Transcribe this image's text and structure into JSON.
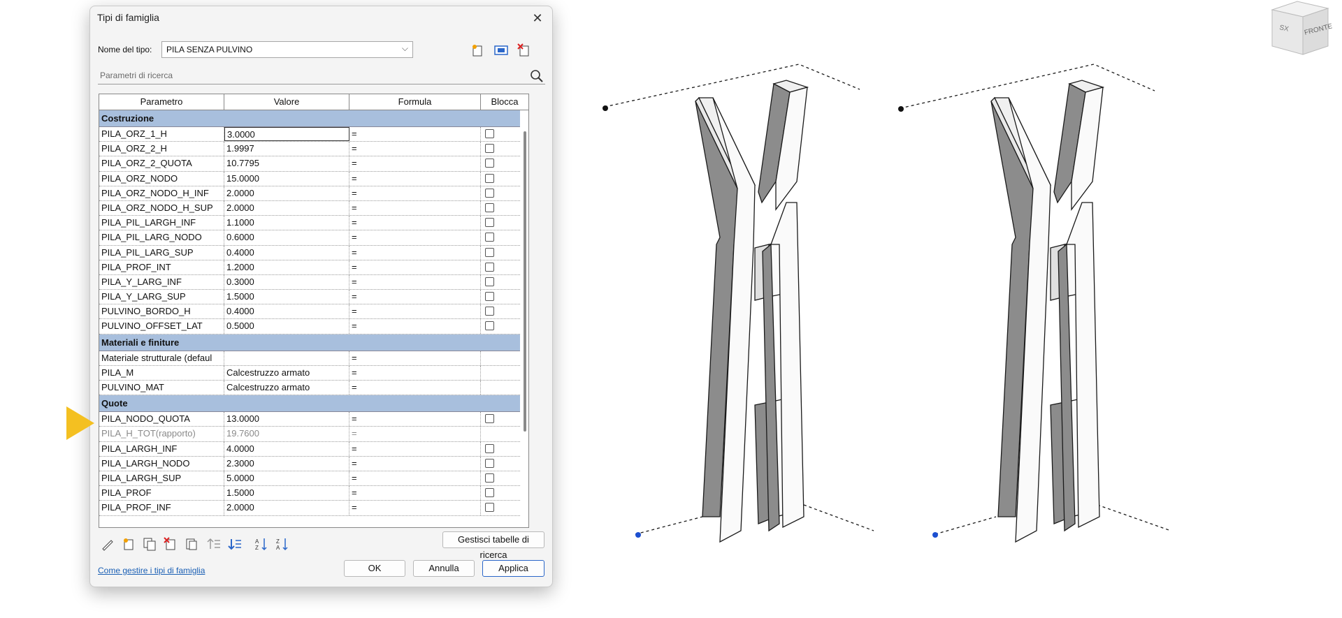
{
  "dialog": {
    "title": "Tipi di famiglia",
    "type_label": "Nome del tipo:",
    "type_value": "PILA SENZA PULVINO",
    "search_placeholder": "Parametri di ricerca",
    "columns": [
      "Parametro",
      "Valore",
      "Formula",
      "Blocca"
    ],
    "groups": [
      {
        "name": "Costruzione",
        "rows": [
          {
            "param": "PILA_ORZ_1_H",
            "value": "3.0000",
            "formula": "=",
            "lock": true
          },
          {
            "param": "PILA_ORZ_2_H",
            "value": "1.9997",
            "formula": "=",
            "lock": true
          },
          {
            "param": "PILA_ORZ_2_QUOTA",
            "value": "10.7795",
            "formula": "=",
            "lock": true
          },
          {
            "param": "PILA_ORZ_NODO",
            "value": "15.0000",
            "formula": "=",
            "lock": true
          },
          {
            "param": "PILA_ORZ_NODO_H_INF",
            "value": "2.0000",
            "formula": "=",
            "lock": true
          },
          {
            "param": "PILA_ORZ_NODO_H_SUP",
            "value": "2.0000",
            "formula": "=",
            "lock": true
          },
          {
            "param": "PILA_PIL_LARGH_INF",
            "value": "1.1000",
            "formula": "=",
            "lock": true
          },
          {
            "param": "PILA_PIL_LARG_NODO",
            "value": "0.6000",
            "formula": "=",
            "lock": true
          },
          {
            "param": "PILA_PIL_LARG_SUP",
            "value": "0.4000",
            "formula": "=",
            "lock": true
          },
          {
            "param": "PILA_PROF_INT",
            "value": "1.2000",
            "formula": "=",
            "lock": true
          },
          {
            "param": "PILA_Y_LARG_INF",
            "value": "0.3000",
            "formula": "=",
            "lock": true
          },
          {
            "param": "PILA_Y_LARG_SUP",
            "value": "1.5000",
            "formula": "=",
            "lock": true
          },
          {
            "param": "PULVINO_BORDO_H",
            "value": "0.4000",
            "formula": "=",
            "lock": true
          },
          {
            "param": "PULVINO_OFFSET_LAT",
            "value": "0.5000",
            "formula": "=",
            "lock": true
          }
        ]
      },
      {
        "name": "Materiali e finiture",
        "rows": [
          {
            "param": "Materiale strutturale (defaul",
            "value": "",
            "formula": "=",
            "lock": false
          },
          {
            "param": "PILA_M",
            "value": "Calcestruzzo armato",
            "formula": "=",
            "lock": false
          },
          {
            "param": "PULVINO_MAT",
            "value": "Calcestruzzo armato",
            "formula": "=",
            "lock": false
          }
        ]
      },
      {
        "name": "Quote",
        "rows": [
          {
            "param": "PILA_NODO_QUOTA",
            "value": "13.0000",
            "formula": "=",
            "lock": true
          },
          {
            "param": "PILA_H_TOT(rapporto)",
            "value": "19.7600",
            "formula": "=",
            "lock": false,
            "muted": true
          },
          {
            "param": "PILA_LARGH_INF",
            "value": "4.0000",
            "formula": "=",
            "lock": true
          },
          {
            "param": "PILA_LARGH_NODO",
            "value": "2.3000",
            "formula": "=",
            "lock": true
          },
          {
            "param": "PILA_LARGH_SUP",
            "value": "5.0000",
            "formula": "=",
            "lock": true
          },
          {
            "param": "PILA_PROF",
            "value": "1.5000",
            "formula": "=",
            "lock": true
          },
          {
            "param": "PILA_PROF_INF",
            "value": "2.0000",
            "formula": "=",
            "lock": true
          }
        ]
      }
    ],
    "manage_lookup_label": "Gestisci tabelle di ricerca",
    "help_link": "Come gestire i tipi di famiglia",
    "ok_label": "OK",
    "cancel_label": "Annulla",
    "apply_label": "Applica"
  },
  "viewcube": {
    "left_label": "SX",
    "front_label": "FRONTE"
  },
  "colors": {
    "group_header": "#a8bfdd",
    "link": "#1a5fb4",
    "marker": "#f4c021",
    "primary_border": "#2a66c9"
  },
  "icons": {
    "top_toolbar": [
      "new-type-icon",
      "rename-type-icon",
      "delete-type-icon"
    ],
    "bottom_toolbar": [
      "edit-parameter-icon",
      "new-parameter-icon",
      "copy-parameter-icon",
      "delete-parameter-icon",
      "paste-icon",
      "move-up-icon",
      "move-down-icon",
      "sort-ascending-icon",
      "sort-descending-icon"
    ]
  }
}
